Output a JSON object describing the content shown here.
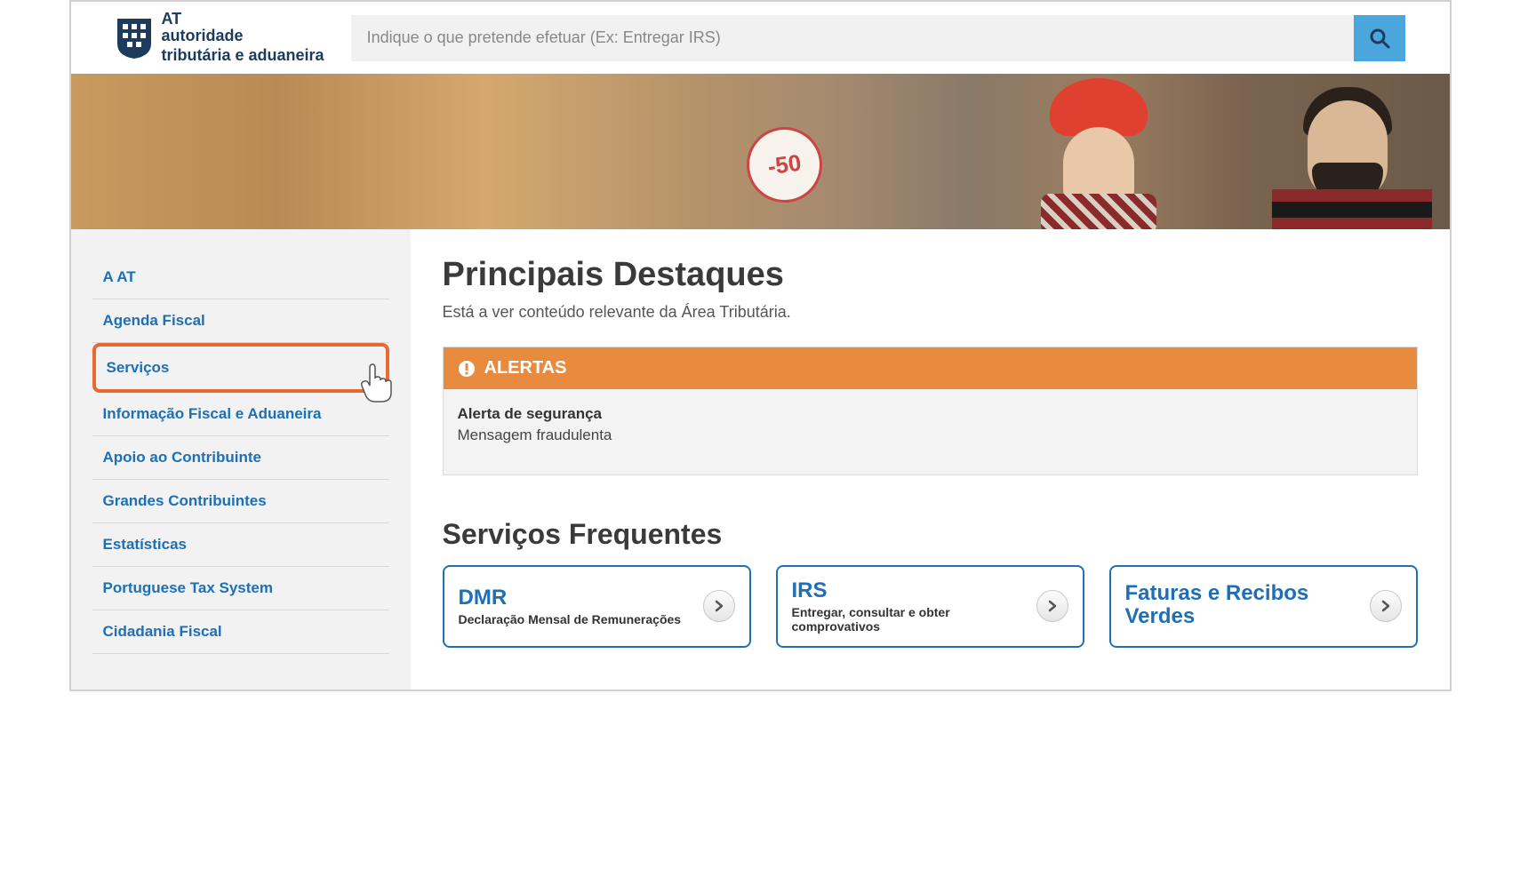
{
  "header": {
    "logo": {
      "line1": "AT",
      "line2": "autoridade",
      "line3": "tributária e aduaneira"
    },
    "search_placeholder": "Indique o que pretende efetuar (Ex: Entregar IRS)"
  },
  "banner": {
    "tag_text": "-50"
  },
  "sidebar": {
    "items": [
      {
        "label": "A AT"
      },
      {
        "label": "Agenda Fiscal"
      },
      {
        "label": "Serviços"
      },
      {
        "label": "Informação Fiscal e Aduaneira"
      },
      {
        "label": "Apoio ao Contribuinte"
      },
      {
        "label": "Grandes Contribuintes"
      },
      {
        "label": "Estatísticas"
      },
      {
        "label": "Portuguese Tax System"
      },
      {
        "label": "Cidadania Fiscal"
      }
    ]
  },
  "main": {
    "heading": "Principais Destaques",
    "subtitle": "Está a ver conteúdo relevante da Área Tributária.",
    "alerts": {
      "header": "ALERTAS",
      "title": "Alerta de segurança",
      "message": "Mensagem fraudulenta"
    },
    "services_heading": "Serviços Frequentes",
    "cards": [
      {
        "title": "DMR",
        "desc": "Declaração Mensal de Remunerações"
      },
      {
        "title": "IRS",
        "desc": "Entregar, consultar e obter comprovativos"
      },
      {
        "title": "Faturas e Recibos Verdes",
        "desc": ""
      }
    ]
  }
}
